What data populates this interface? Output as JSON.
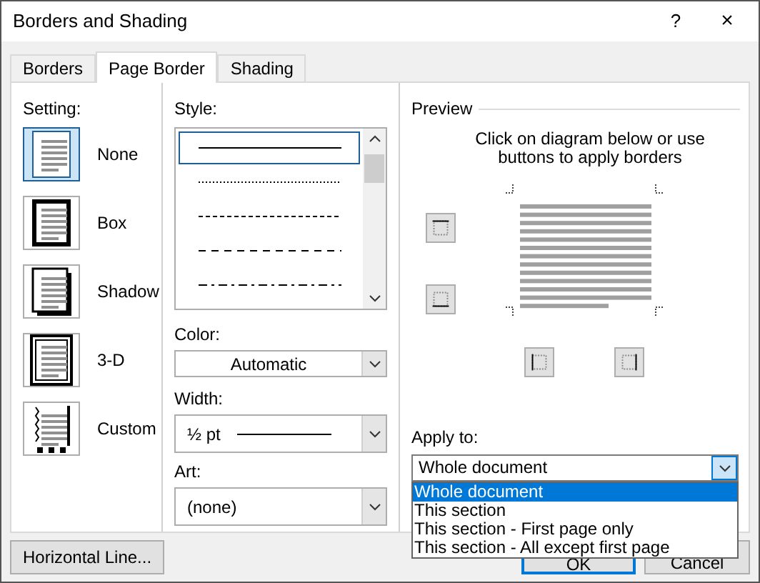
{
  "window": {
    "title": "Borders and Shading",
    "help": "?",
    "close": "×"
  },
  "tabs": [
    {
      "label": "Borders",
      "selected": false
    },
    {
      "label": "Page Border",
      "selected": true
    },
    {
      "label": "Shading",
      "selected": false
    }
  ],
  "setting": {
    "label": "Setting:",
    "items": [
      {
        "label": "None",
        "kind": "none",
        "selected": true
      },
      {
        "label": "Box",
        "kind": "box",
        "selected": false
      },
      {
        "label": "Shadow",
        "kind": "shadow",
        "selected": false
      },
      {
        "label": "3-D",
        "kind": "threed",
        "selected": false
      },
      {
        "label": "Custom",
        "kind": "custom",
        "selected": false
      }
    ]
  },
  "style": {
    "label": "Style:",
    "options": [
      {
        "kind": "solid",
        "selected": true
      },
      {
        "kind": "dotted",
        "selected": false
      },
      {
        "kind": "dashed",
        "selected": false
      },
      {
        "kind": "long-dash",
        "selected": false
      },
      {
        "kind": "dash-dot",
        "selected": false
      }
    ]
  },
  "color": {
    "label": "Color:",
    "value": "Automatic"
  },
  "width": {
    "label": "Width:",
    "value": "½ pt"
  },
  "art": {
    "label": "Art:",
    "value": "(none)"
  },
  "preview": {
    "label": "Preview",
    "hint": "Click on diagram below or use buttons to apply borders"
  },
  "apply_to": {
    "label": "Apply to:",
    "value": "Whole document",
    "expanded": true,
    "options": [
      {
        "label": "Whole document",
        "selected": true
      },
      {
        "label": "This section",
        "selected": false
      },
      {
        "label": "This section - First page only",
        "selected": false
      },
      {
        "label": "This section - All except first page",
        "selected": false
      }
    ]
  },
  "buttons": {
    "horizontal_line": "Horizontal Line...",
    "ok": "OK",
    "cancel": "Cancel"
  }
}
